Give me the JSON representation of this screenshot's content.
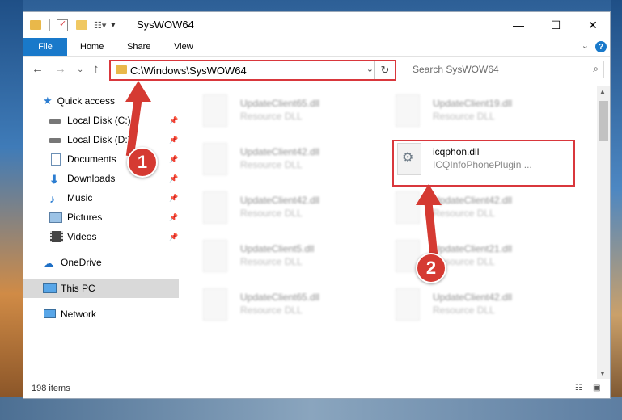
{
  "window": {
    "title": "SysWOW64",
    "controls": {
      "minimize": "—",
      "maximize": "☐",
      "close": "✕"
    }
  },
  "ribbon": {
    "file": "File",
    "tabs": [
      "Home",
      "Share",
      "View"
    ],
    "help": "?",
    "expand": "⌄"
  },
  "navigation": {
    "back": "←",
    "forward": "→",
    "recent": "⌄",
    "up": "↑",
    "address": "C:\\Windows\\SysWOW64",
    "address_dropdown": "⌄",
    "refresh": "↻",
    "search_placeholder": "Search SysWOW64"
  },
  "sidebar": {
    "items": [
      {
        "label": "Quick access",
        "icon": "star-icon"
      },
      {
        "label": "Local Disk (C:)",
        "icon": "drive-icon",
        "pinned": true
      },
      {
        "label": "Local Disk (D:)",
        "icon": "drive-icon",
        "pinned": true
      },
      {
        "label": "Documents",
        "icon": "document-icon",
        "pinned": true
      },
      {
        "label": "Downloads",
        "icon": "download-icon",
        "pinned": true
      },
      {
        "label": "Music",
        "icon": "music-icon",
        "pinned": true
      },
      {
        "label": "Pictures",
        "icon": "pictures-icon",
        "pinned": true
      },
      {
        "label": "Videos",
        "icon": "video-icon",
        "pinned": true
      },
      {
        "label": "OneDrive",
        "icon": "cloud-icon"
      },
      {
        "label": "This PC",
        "icon": "computer-icon",
        "selected": true
      },
      {
        "label": "Network",
        "icon": "network-icon"
      }
    ]
  },
  "files": [
    {
      "name": "UpdateClient65.dll",
      "desc": "Resource DLL"
    },
    {
      "name": "UpdateClient19.dll",
      "desc": "Resource DLL"
    },
    {
      "name": "UpdateClient42.dll",
      "desc": "Resource DLL"
    },
    {
      "name": "icqphon.dll",
      "desc": "ICQInfoPhonePlugin ..."
    },
    {
      "name": "UpdateClient42.dll",
      "desc": "Resource DLL"
    },
    {
      "name": "UpdateClient42.dll",
      "desc": "Resource DLL"
    },
    {
      "name": "UpdateClient5.dll",
      "desc": "Resource DLL"
    },
    {
      "name": "UpdateClient21.dll",
      "desc": "Resource DLL"
    },
    {
      "name": "UpdateClient65.dll",
      "desc": "Resource DLL"
    },
    {
      "name": "UpdateClient42.dll",
      "desc": "Resource DLL"
    }
  ],
  "status": {
    "items": "198 items"
  },
  "markers": {
    "one": "1",
    "two": "2"
  },
  "colors": {
    "accent": "#1979ca",
    "highlight": "#d9373c",
    "marker": "#d53a32",
    "selected": "#d9d9d9"
  }
}
